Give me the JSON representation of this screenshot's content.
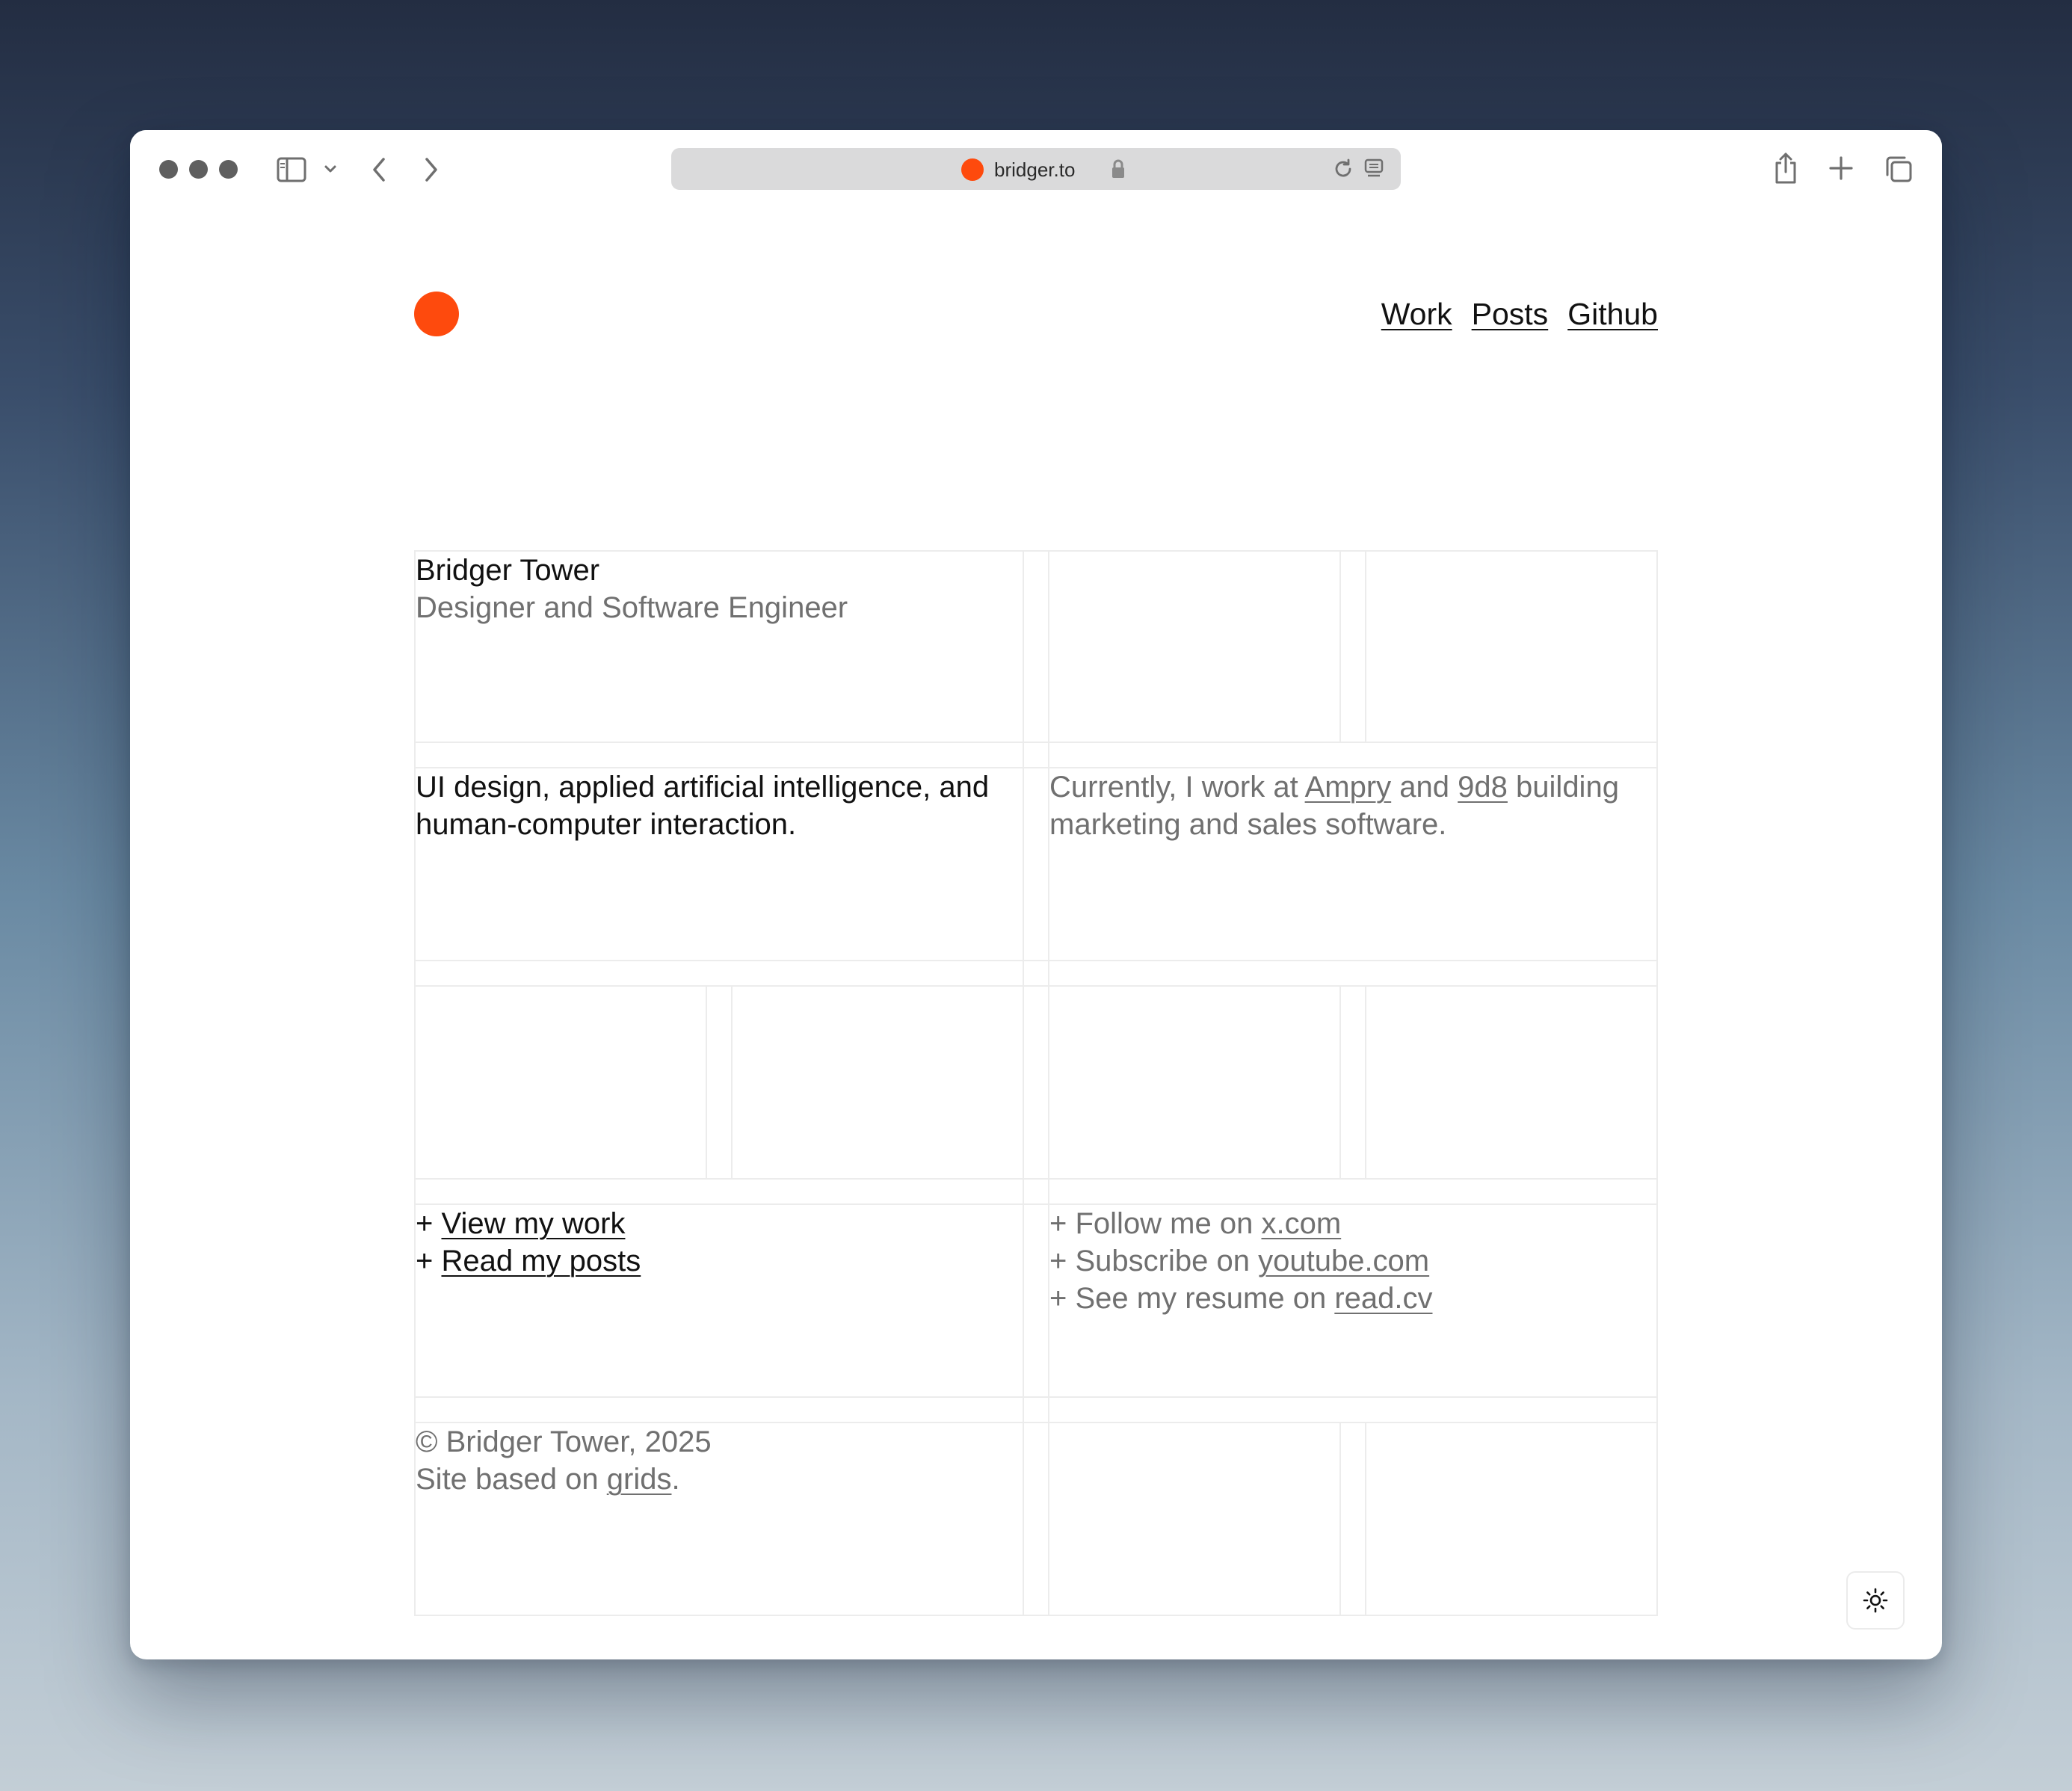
{
  "browser": {
    "url": "bridger.to",
    "icons": [
      "window-dot-icon",
      "sidebar-icon",
      "chevron-down-icon",
      "back-icon",
      "forward-icon",
      "lock-icon",
      "reload-icon",
      "reader-icon",
      "share-icon",
      "new-tab-icon",
      "tabs-overview-icon"
    ]
  },
  "brand_color": "#fe4a0d",
  "nav": {
    "items": [
      "Work",
      "Posts",
      "Github"
    ]
  },
  "profile": {
    "name": "Bridger Tower",
    "title": "Designer and Software Engineer"
  },
  "about": {
    "focus": "UI design, applied artificial intelligence, and human-computer interaction.",
    "work_prefix": "Currently, I work at",
    "company1": "Ampry",
    "and": "and",
    "company2": "9d8",
    "work_suffix": "building marketing and sales software."
  },
  "links": {
    "plus": "+",
    "view_work": "View my work",
    "read_posts": "Read my posts",
    "follow_prefix": "Follow me on",
    "follow_link": "x.com",
    "subscribe_prefix": "Subscribe on",
    "subscribe_link": "youtube.com",
    "resume_prefix": "See my resume on",
    "resume_link": "read.cv"
  },
  "footer": {
    "copyright": "© Bridger Tower, 2025",
    "site_prefix": "Site based on",
    "site_link": "grids",
    "site_suffix": "."
  },
  "theme_toggle": {
    "icon": "sun-icon"
  }
}
